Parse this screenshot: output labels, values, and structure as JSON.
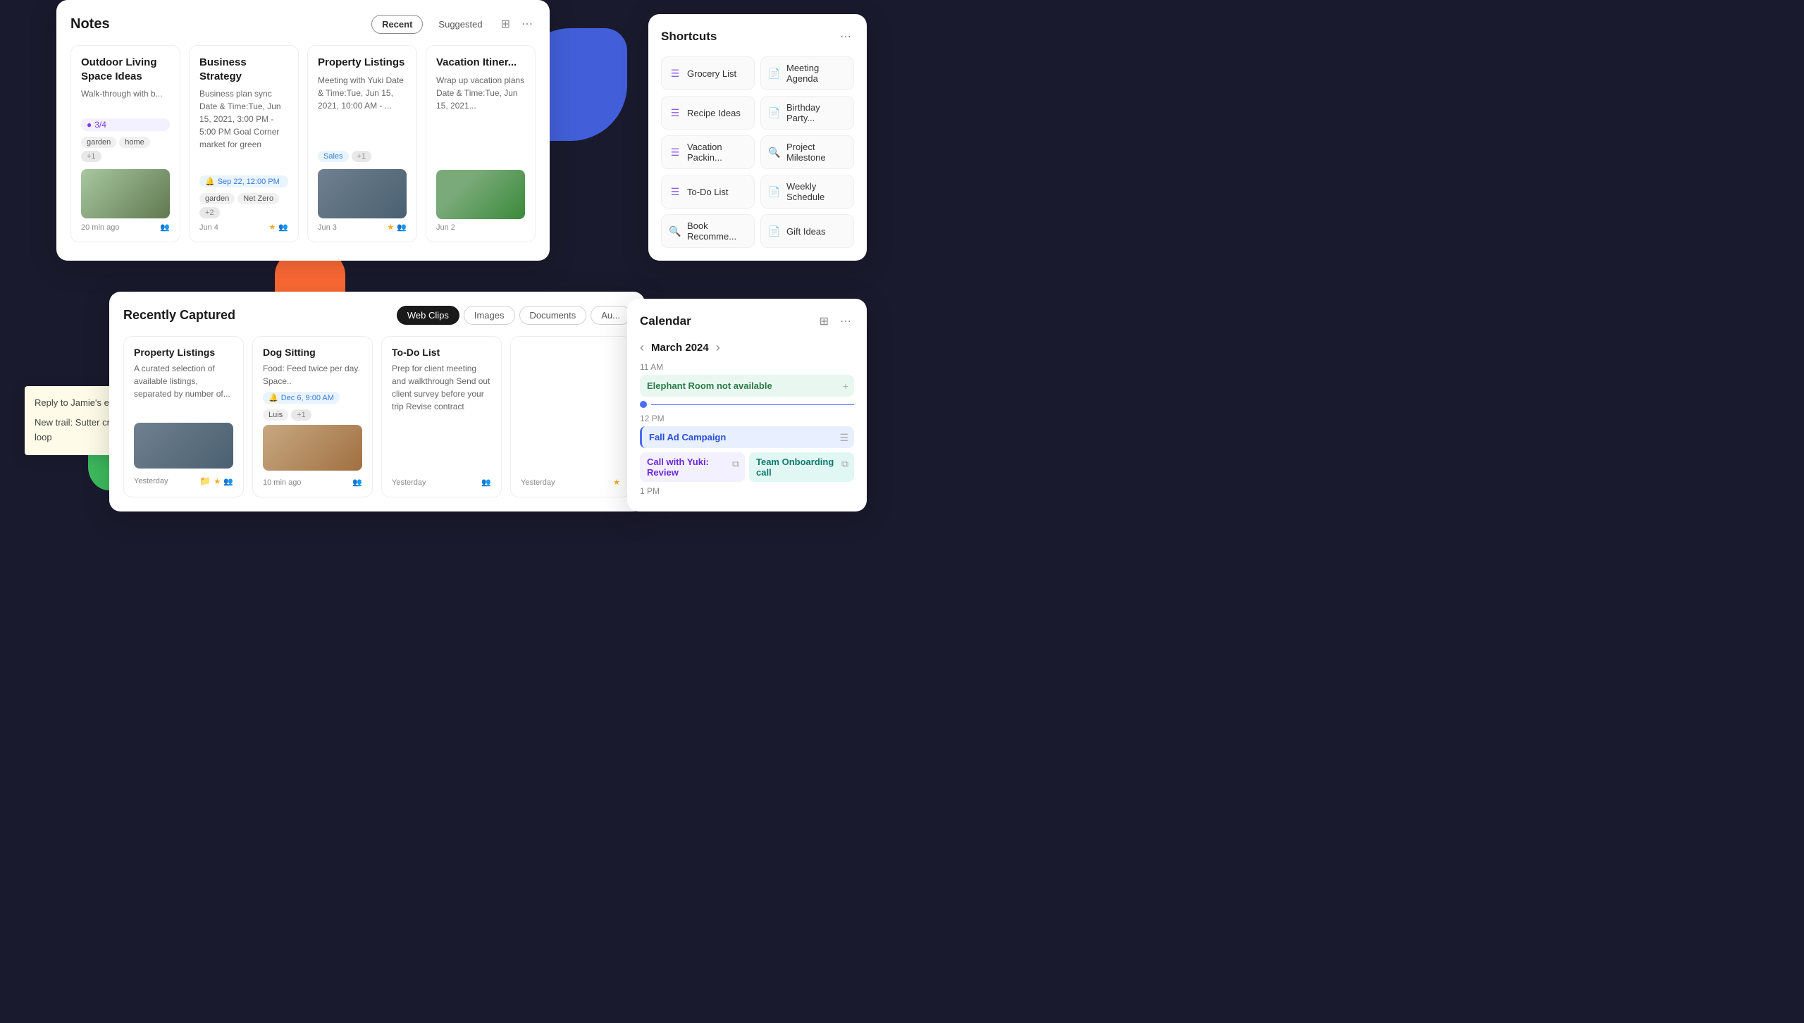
{
  "decorative": {
    "shapes": [
      "blue-drop",
      "green-circle",
      "green-blob",
      "orange-arc"
    ]
  },
  "notes_panel": {
    "title": "Notes",
    "tab_recent": "Recent",
    "tab_suggested": "Suggested",
    "cards": [
      {
        "title": "Outdoor Living Space Ideas",
        "body": "Walk-through with b...",
        "progress": "3/4",
        "tags": [
          "garden",
          "home",
          "+1"
        ],
        "footer_date": "20 min ago",
        "has_image": true,
        "image_type": "garden",
        "has_people": true,
        "has_star": false
      },
      {
        "title": "Business Strategy",
        "body": "Business plan sync Date & Time:Tue, Jun 15, 2021, 3:00 PM - 5:00 PM Goal Corner market for green",
        "alarm": "Sep 22, 12:00 PM",
        "tags": [
          "garden",
          "Net Zero",
          "+2"
        ],
        "footer_date": "Jun 4",
        "has_star": true,
        "has_people": true,
        "has_image": false
      },
      {
        "title": "Property Listings",
        "body": "Meeting with Yuki Date & Time:Tue, Jun 15, 2021, 10:00 AM - ...",
        "tags": [
          "Sales",
          "+1"
        ],
        "footer_date": "Jun 3",
        "has_star": true,
        "has_people": true,
        "has_image": true,
        "image_type": "property"
      },
      {
        "title": "Vacation Itiner...",
        "body": "Wrap up vacation plans Date & Time:Tue, Jun 15, 2021...",
        "has_image": true,
        "image_type": "vacation",
        "footer_date": "Jun 2",
        "has_star": false,
        "has_people": false
      }
    ]
  },
  "shortcuts_panel": {
    "title": "Shortcuts",
    "more_icon": "⋯",
    "items": [
      {
        "label": "Grocery List",
        "icon_type": "list",
        "icon": "☰"
      },
      {
        "label": "Meeting Agenda",
        "icon_type": "doc",
        "icon": "📄"
      },
      {
        "label": "Recipe Ideas",
        "icon_type": "list",
        "icon": "☰"
      },
      {
        "label": "Birthday Party...",
        "icon_type": "doc",
        "icon": "📄"
      },
      {
        "label": "Vacation Packin...",
        "icon_type": "list",
        "icon": "☰"
      },
      {
        "label": "Project Milestone",
        "icon_type": "search",
        "icon": "🔍"
      },
      {
        "label": "To-Do List",
        "icon_type": "list",
        "icon": "☰"
      },
      {
        "label": "Weekly Schedule",
        "icon_type": "doc",
        "icon": "📄"
      },
      {
        "label": "Book Recomme...",
        "icon_type": "search",
        "icon": "🔍"
      },
      {
        "label": "Gift Ideas",
        "icon_type": "doc",
        "icon": "📄"
      }
    ]
  },
  "sticky_note": {
    "lines": [
      "Reply to Jamie's email",
      "New trail: Sutter creek loop"
    ]
  },
  "recent_panel": {
    "title": "Recently Captured",
    "tabs": [
      "Web Clips",
      "Images",
      "Documents",
      "Au..."
    ],
    "active_tab": "Web Clips",
    "cards": [
      {
        "title": "Property Listings",
        "body": "A curated selection of available listings, separated by number of...",
        "footer_date": "Yesterday",
        "has_image": true,
        "image_type": "property2",
        "has_star": false,
        "has_people": true,
        "has_folder": true
      },
      {
        "title": "Dog Sitting",
        "body": "Food: Feed twice per day. Space..",
        "alarm": "Dec 6, 9:00 AM",
        "people": [
          "Luis",
          "+1"
        ],
        "footer_date": "10 min ago",
        "has_image": true,
        "image_type": "dog",
        "has_people": true
      },
      {
        "title": "To-Do List",
        "body": "Prep for client meeting and walkthrough Send out client survey before your trip Revise contract",
        "footer_date": "Yesterday",
        "has_people": true
      },
      {
        "title": "...",
        "body": "",
        "footer_date": "Yesterday",
        "has_star": true
      }
    ]
  },
  "calendar_panel": {
    "title": "Calendar",
    "month": "March 2024",
    "time_11am": "11 AM",
    "time_12pm": "12 PM",
    "time_1pm": "1 PM",
    "events": [
      {
        "title": "Elephant Room not available",
        "type": "green"
      },
      {
        "title": "Fall Ad Campaign",
        "type": "blue"
      },
      {
        "title": "Call with Yuki: Review",
        "type": "purple"
      },
      {
        "title": "Team Onboarding call",
        "type": "teal"
      }
    ]
  }
}
